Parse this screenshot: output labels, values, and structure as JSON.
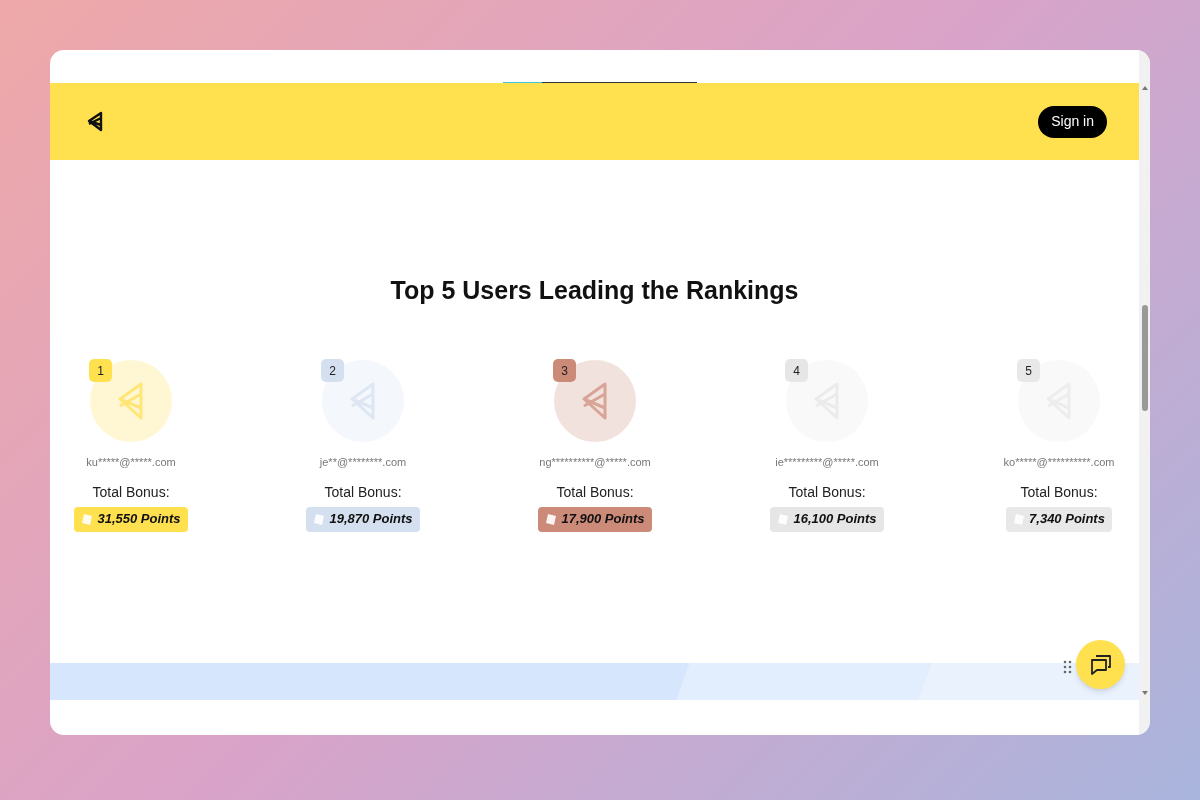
{
  "header": {
    "sign_in": "Sign in",
    "indicator": {
      "level": 0.2
    }
  },
  "title": "Top 5 Users Leading the Rankings",
  "users": [
    {
      "rank": "1",
      "email": "ku*****@*****.com",
      "label": "Total Bonus:",
      "points": "31,550 Points",
      "color": "#ffe04f"
    },
    {
      "rank": "2",
      "email": "je**@********.com",
      "label": "Total Bonus:",
      "points": "19,870 Points",
      "color": "#d4e0ef"
    },
    {
      "rank": "3",
      "email": "ng**********@*****.com",
      "label": "Total Bonus:",
      "points": "17,900 Points",
      "color": "#cc8a79"
    },
    {
      "rank": "4",
      "email": "ie*********@*****.com",
      "label": "Total Bonus:",
      "points": "16,100 Points",
      "color": "#e6e6e6"
    },
    {
      "rank": "5",
      "email": "ko*****@**********.com",
      "label": "Total Bonus:",
      "points": "7,340 Points",
      "color": "#e8e8e8"
    }
  ]
}
